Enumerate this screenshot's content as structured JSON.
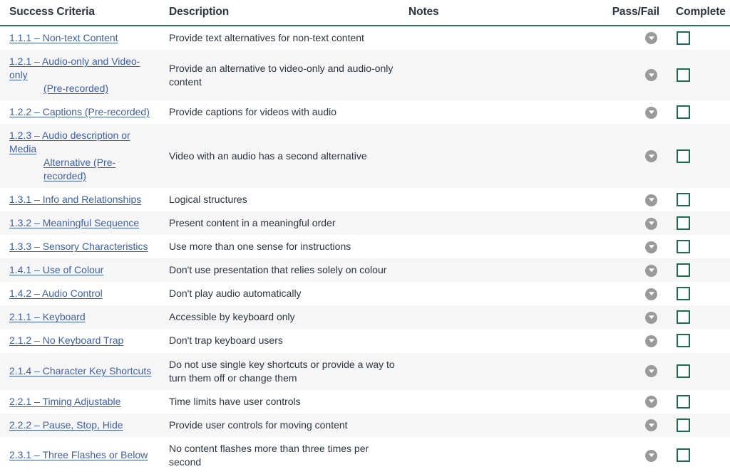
{
  "table": {
    "columns": [
      {
        "key": "criteria",
        "label": "Success Criteria"
      },
      {
        "key": "description",
        "label": "Description"
      },
      {
        "key": "notes",
        "label": "Notes"
      },
      {
        "key": "passfail",
        "label": "Pass/Fail"
      },
      {
        "key": "complete",
        "label": "Complete"
      }
    ],
    "header_rule_color": "#2d7355",
    "link_color": "#3d5fa8",
    "checkbox_color": "#1d6b53",
    "dropdown_color": "#9a9a9a",
    "stripe_color": "#f6f6f7",
    "rows": [
      {
        "criteria_line1": "1.1.1 – Non-text Content",
        "criteria_line2": "",
        "description": "Provide text alternatives for non-text content",
        "notes": "",
        "passfail_icon": "chevron-down-circle-icon",
        "complete_checked": false
      },
      {
        "criteria_line1": "1.2.1 – Audio-only and Video-only",
        "criteria_line2": "(Pre-recorded)",
        "description": "Provide an alternative to video-only and audio-only content",
        "notes": "",
        "passfail_icon": "chevron-down-circle-icon",
        "complete_checked": false
      },
      {
        "criteria_line1": "1.2.2 – Captions (Pre-recorded)",
        "criteria_line2": "",
        "description": "Provide captions for videos with audio",
        "notes": "",
        "passfail_icon": "chevron-down-circle-icon",
        "complete_checked": false
      },
      {
        "criteria_line1": "1.2.3 – Audio description or Media",
        "criteria_line2": "Alternative (Pre-recorded)",
        "description": "Video with an audio has a second alternative",
        "notes": "",
        "passfail_icon": "chevron-down-circle-icon",
        "complete_checked": false
      },
      {
        "criteria_line1": "1.3.1 – Info and Relationships",
        "criteria_line2": "",
        "description": "Logical structures",
        "notes": "",
        "passfail_icon": "chevron-down-circle-icon",
        "complete_checked": false
      },
      {
        "criteria_line1": "1.3.2 – Meaningful Sequence",
        "criteria_line2": "",
        "description": "Present content in a meaningful order",
        "notes": "",
        "passfail_icon": "chevron-down-circle-icon",
        "complete_checked": false
      },
      {
        "criteria_line1": "1.3.3 – Sensory Characteristics",
        "criteria_line2": "",
        "description": "Use more than one sense for instructions",
        "notes": "",
        "passfail_icon": "chevron-down-circle-icon",
        "complete_checked": false
      },
      {
        "criteria_line1": "1.4.1 – Use of Colour",
        "criteria_line2": "",
        "description": "Don't use presentation that relies solely on colour",
        "notes": "",
        "passfail_icon": "chevron-down-circle-icon",
        "complete_checked": false
      },
      {
        "criteria_line1": "1.4.2 – Audio Control",
        "criteria_line2": "",
        "description": "Don't play audio automatically",
        "notes": "",
        "passfail_icon": "chevron-down-circle-icon",
        "complete_checked": false
      },
      {
        "criteria_line1": "2.1.1 – Keyboard",
        "criteria_line2": "",
        "description": "Accessible by keyboard only",
        "notes": "",
        "passfail_icon": "chevron-down-circle-icon",
        "complete_checked": false
      },
      {
        "criteria_line1": "2.1.2 – No Keyboard Trap",
        "criteria_line2": "",
        "description": "Don't trap keyboard users",
        "notes": "",
        "passfail_icon": "chevron-down-circle-icon",
        "complete_checked": false
      },
      {
        "criteria_line1": "2.1.4 – Character Key Shortcuts",
        "criteria_line2": "",
        "description": "Do not use single key shortcuts or provide a way to turn them off or change them",
        "notes": "",
        "passfail_icon": "chevron-down-circle-icon",
        "complete_checked": false
      },
      {
        "criteria_line1": "2.2.1 – Timing Adjustable",
        "criteria_line2": "",
        "description": "Time limits have user controls",
        "notes": "",
        "passfail_icon": "chevron-down-circle-icon",
        "complete_checked": false
      },
      {
        "criteria_line1": "2.2.2 – Pause, Stop, Hide",
        "criteria_line2": "",
        "description": "Provide user controls for moving content",
        "notes": "",
        "passfail_icon": "chevron-down-circle-icon",
        "complete_checked": false
      },
      {
        "criteria_line1": "2.3.1 – Three Flashes or Below",
        "criteria_line2": "",
        "description": "No content flashes more than three times per second",
        "notes": "",
        "passfail_icon": "chevron-down-circle-icon",
        "complete_checked": false
      }
    ]
  }
}
